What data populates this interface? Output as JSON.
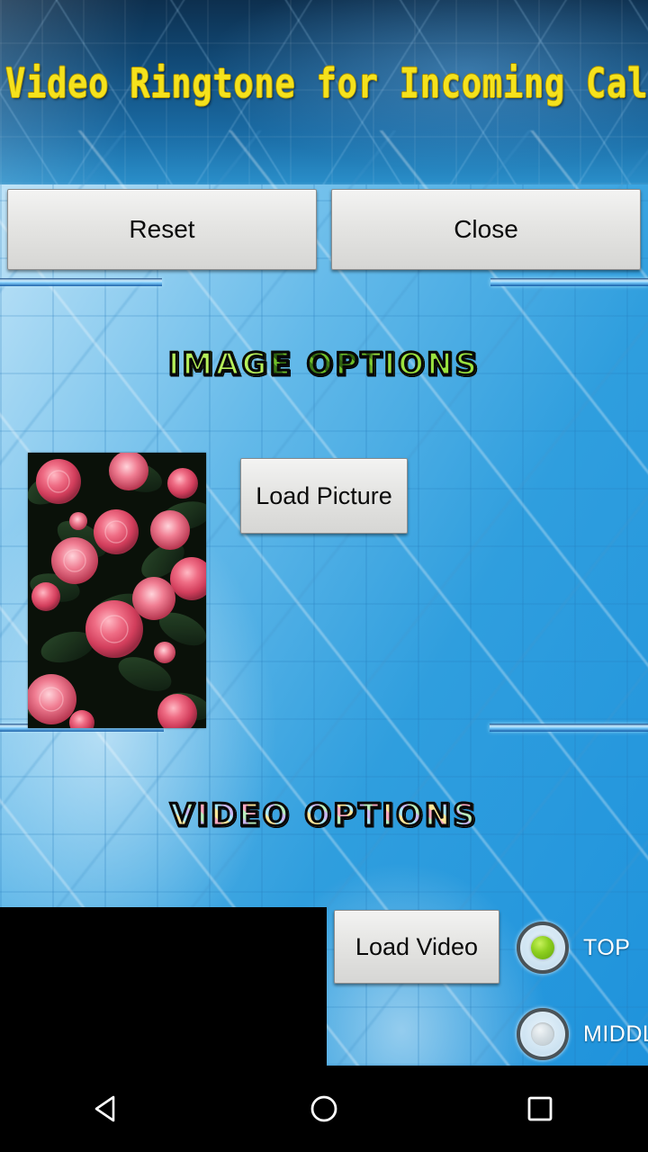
{
  "app": {
    "title": "Video Ringtone for Incoming Call"
  },
  "toolbar": {
    "reset_label": "Reset",
    "close_label": "Close"
  },
  "sections": {
    "image": {
      "heading": "IMAGE OPTIONS",
      "load_picture_label": "Load Picture",
      "thumbnail_alt": "roses-photo-thumbnail"
    },
    "video": {
      "heading": "VIDEO OPTIONS",
      "load_video_label": "Load Video",
      "preview_alt": "video-preview-black",
      "position_options": [
        {
          "label": "TOP",
          "selected": true
        },
        {
          "label": "MIDDLE",
          "selected": false
        }
      ]
    }
  },
  "navbar": {
    "back_label": "back-icon",
    "home_label": "home-icon",
    "recents_label": "recents-icon"
  },
  "colors": {
    "title_yellow": "#f5e21c",
    "header_blue_dark": "#0d2f4e",
    "body_blue": "#2f9ede",
    "button_face": "#e4e4e2",
    "radio_selected_green": "#8ed020",
    "radio_ring": "#4a5358",
    "nav_icon_white": "#ffffff"
  }
}
